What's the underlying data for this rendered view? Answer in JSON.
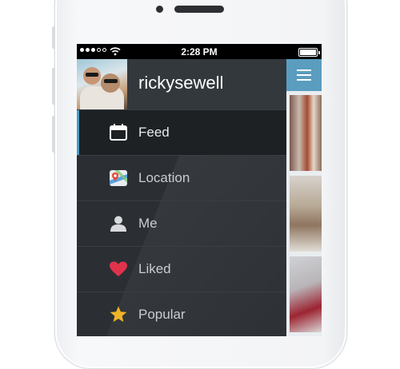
{
  "status_bar": {
    "time": "2:28 PM"
  },
  "profile": {
    "username": "rickysewell"
  },
  "menu": {
    "items": [
      {
        "label": "Feed",
        "icon": "calendar-icon",
        "active": true
      },
      {
        "label": "Location",
        "icon": "map-icon",
        "active": false
      },
      {
        "label": "Me",
        "icon": "person-icon",
        "active": false
      },
      {
        "label": "Liked",
        "icon": "heart-icon",
        "active": false
      },
      {
        "label": "Popular",
        "icon": "star-icon",
        "active": false
      }
    ]
  },
  "colors": {
    "accent": "#5a9dbf",
    "heart": "#e0334b",
    "star": "#f0b429"
  }
}
